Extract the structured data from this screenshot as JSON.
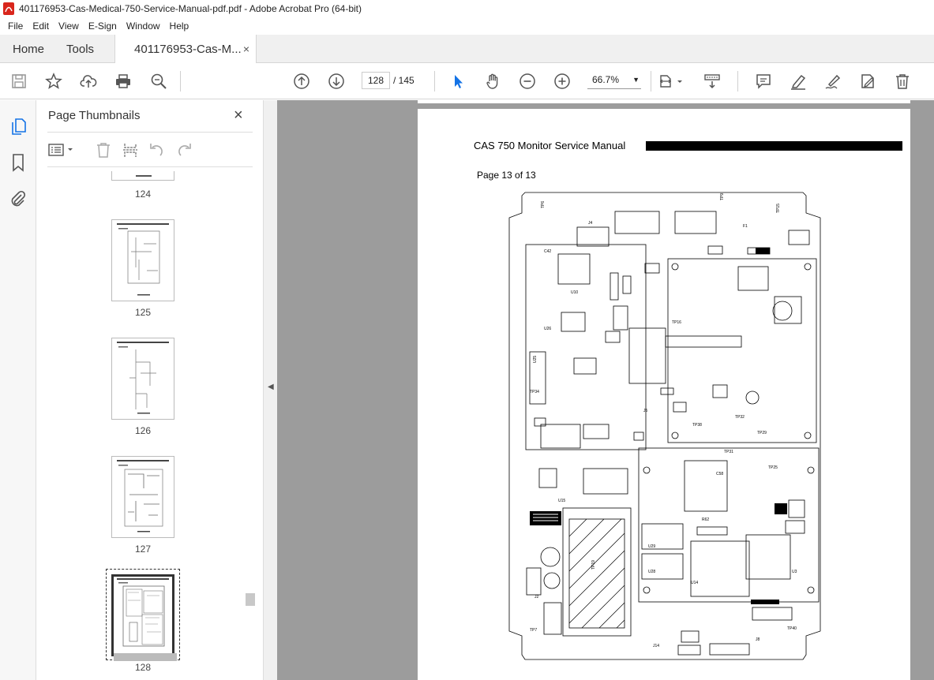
{
  "window": {
    "title": "401176953-Cas-Medical-750-Service-Manual-pdf.pdf - Adobe Acrobat Pro (64-bit)"
  },
  "menu": [
    "File",
    "Edit",
    "View",
    "E-Sign",
    "Window",
    "Help"
  ],
  "tabs": {
    "home": "Home",
    "tools": "Tools",
    "doc": "401176953-Cas-M...",
    "close": "×"
  },
  "toolbar": {
    "current_page": "128",
    "page_total": "/ 145",
    "zoom": "66.7%",
    "icons": [
      "save-icon",
      "star-icon",
      "upload-icon",
      "print-icon",
      "search-zoom-icon",
      "page-up-icon",
      "page-down-icon",
      "select-pointer-icon",
      "hand-icon",
      "zoom-out-icon",
      "zoom-in-icon",
      "fit-page-icon",
      "scroll-mode-icon",
      "comment-icon",
      "highlight-icon",
      "sign-icon",
      "edit-pdf-icon",
      "delete-icon"
    ]
  },
  "panel": {
    "title": "Page Thumbnails",
    "close": "×",
    "thumbnails": [
      {
        "label": "124"
      },
      {
        "label": "125"
      },
      {
        "label": "126"
      },
      {
        "label": "127"
      },
      {
        "label": "128",
        "selected": true
      }
    ]
  },
  "document": {
    "header": "CAS 750 Monitor Service Manual",
    "page_line": "Page 13 of 13"
  }
}
